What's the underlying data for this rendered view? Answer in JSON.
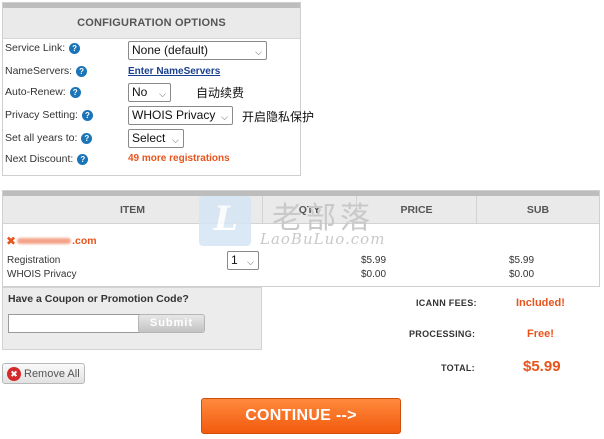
{
  "config": {
    "title": "CONFIGURATION OPTIONS",
    "service_link_label": "Service Link:",
    "service_link_value": "None (default)",
    "nameservers_label": "NameServers:",
    "nameservers_link": "Enter NameServers",
    "auto_renew_label": "Auto-Renew:",
    "auto_renew_value": "No",
    "auto_renew_note": "自动续费",
    "privacy_label": "Privacy Setting:",
    "privacy_value": "WHOIS Privacy",
    "privacy_note": "开启隐私保护",
    "years_label": "Set all years to:",
    "years_value": "Select",
    "discount_label": "Next Discount:",
    "discount_value": "49 more registrations",
    "help_glyph": "?"
  },
  "cart": {
    "headers": {
      "item": "ITEM",
      "qty": "QTY",
      "price": "PRICE",
      "sub": "SUB"
    },
    "domain_x": "✖",
    "domain_suffix": ".com",
    "rows": [
      {
        "name": "Registration",
        "qty": "1",
        "price": "$5.99",
        "sub": "$5.99"
      },
      {
        "name": "WHOIS Privacy",
        "price": "$0.00",
        "sub": "$0.00"
      }
    ]
  },
  "watermark": {
    "glyph": "L",
    "cn": "老部落",
    "en": "LaoBuLuo.com"
  },
  "coupon": {
    "title": "Have a Coupon or Promotion Code?",
    "input_value": "",
    "submit": "Submit"
  },
  "fees": {
    "icann_label": "ICANN FEES:",
    "icann_value": "Included!",
    "processing_label": "PROCESSING:",
    "processing_value": "Free!",
    "total_label": "TOTAL:",
    "total_value": "$5.99"
  },
  "actions": {
    "remove_all": "Remove All",
    "remove_icon_glyph": "✖",
    "continue": "CONTINUE -->"
  },
  "colors": {
    "accent": "#e8541b",
    "link": "#1b3f8f",
    "help": "#1a74b8"
  }
}
